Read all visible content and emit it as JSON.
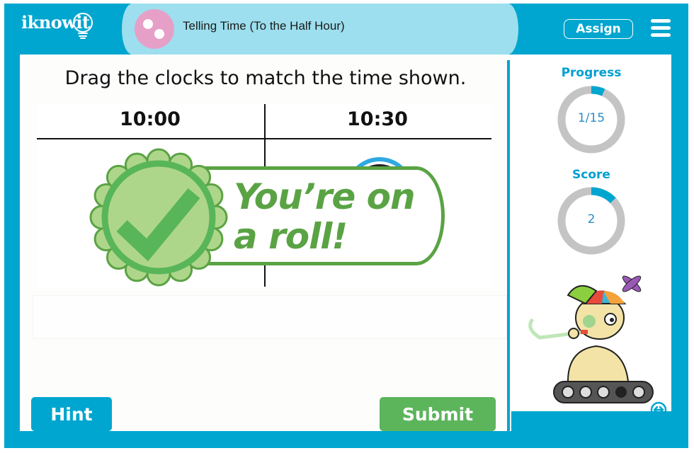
{
  "header": {
    "logo_text": "iknowit",
    "topic_icon": "two-dots-icon",
    "title": "Telling Time (To the Half Hour)",
    "assign_label": "Assign",
    "menu_icon": "hamburger-menu-icon"
  },
  "activity": {
    "instruction": "Drag the clocks to match the time shown.",
    "columns": [
      {
        "label": "10:00"
      },
      {
        "label": "10:30"
      }
    ],
    "feedback": {
      "line1": "You’re on",
      "line2": "a roll!",
      "icon": "checkmark-seal-icon"
    }
  },
  "buttons": {
    "hint_label": "Hint",
    "submit_label": "Submit"
  },
  "sidebar": {
    "progress": {
      "label": "Progress",
      "value_text": "1/15",
      "current": 1,
      "total": 15
    },
    "score": {
      "label": "Score",
      "value_text": "2",
      "fraction": 0.13
    },
    "mascot": "robot-mascot-with-party-blower",
    "swap_icon": "swap-horizontal-icon"
  },
  "colors": {
    "frame": "#00a6cf",
    "title_pill": "#9ddfee",
    "topic_icon": "#e6a0c8",
    "success_green": "#5aa344",
    "submit_green": "#5cb55b",
    "ring_track": "#c4c4c4",
    "ring_fill": "#00a6cf"
  }
}
